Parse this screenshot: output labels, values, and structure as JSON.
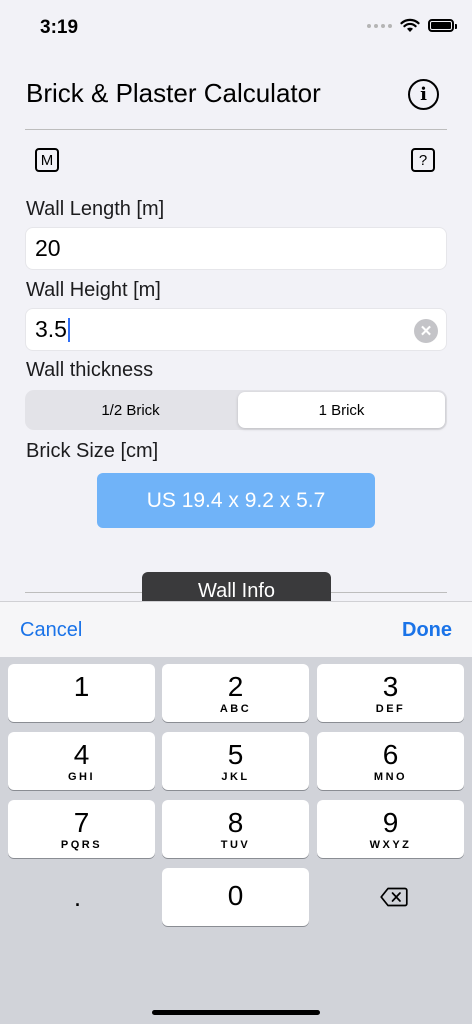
{
  "status": {
    "time": "3:19"
  },
  "header": {
    "title": "Brick & Plaster Calculator",
    "info_glyph": "i",
    "m_glyph": "M",
    "help_glyph": "?"
  },
  "form": {
    "length_label": "Wall Length [m]",
    "length_value": "20",
    "height_label": "Wall Height [m]",
    "height_value": "3.5",
    "thickness_label": "Wall thickness",
    "thickness_options": [
      "1/2 Brick",
      "1 Brick"
    ],
    "thickness_selected": "1 Brick",
    "brick_size_label": "Brick Size [cm]",
    "brick_size_value": "US 19.4 x 9.2 x 5.7"
  },
  "wall_info_tab": "Wall Info",
  "toolbar": {
    "cancel": "Cancel",
    "done": "Done"
  },
  "keypad": {
    "keys": [
      {
        "num": "1",
        "letters": ""
      },
      {
        "num": "2",
        "letters": "ABC"
      },
      {
        "num": "3",
        "letters": "DEF"
      },
      {
        "num": "4",
        "letters": "GHI"
      },
      {
        "num": "5",
        "letters": "JKL"
      },
      {
        "num": "6",
        "letters": "MNO"
      },
      {
        "num": "7",
        "letters": "PQRS"
      },
      {
        "num": "8",
        "letters": "TUV"
      },
      {
        "num": "9",
        "letters": "WXYZ"
      },
      {
        "num": "0",
        "letters": ""
      }
    ],
    "decimal": "."
  },
  "colors": {
    "accent": "#1a73e8",
    "brick_button": "#70b3f8",
    "tab_bg": "#3a3a3c"
  }
}
